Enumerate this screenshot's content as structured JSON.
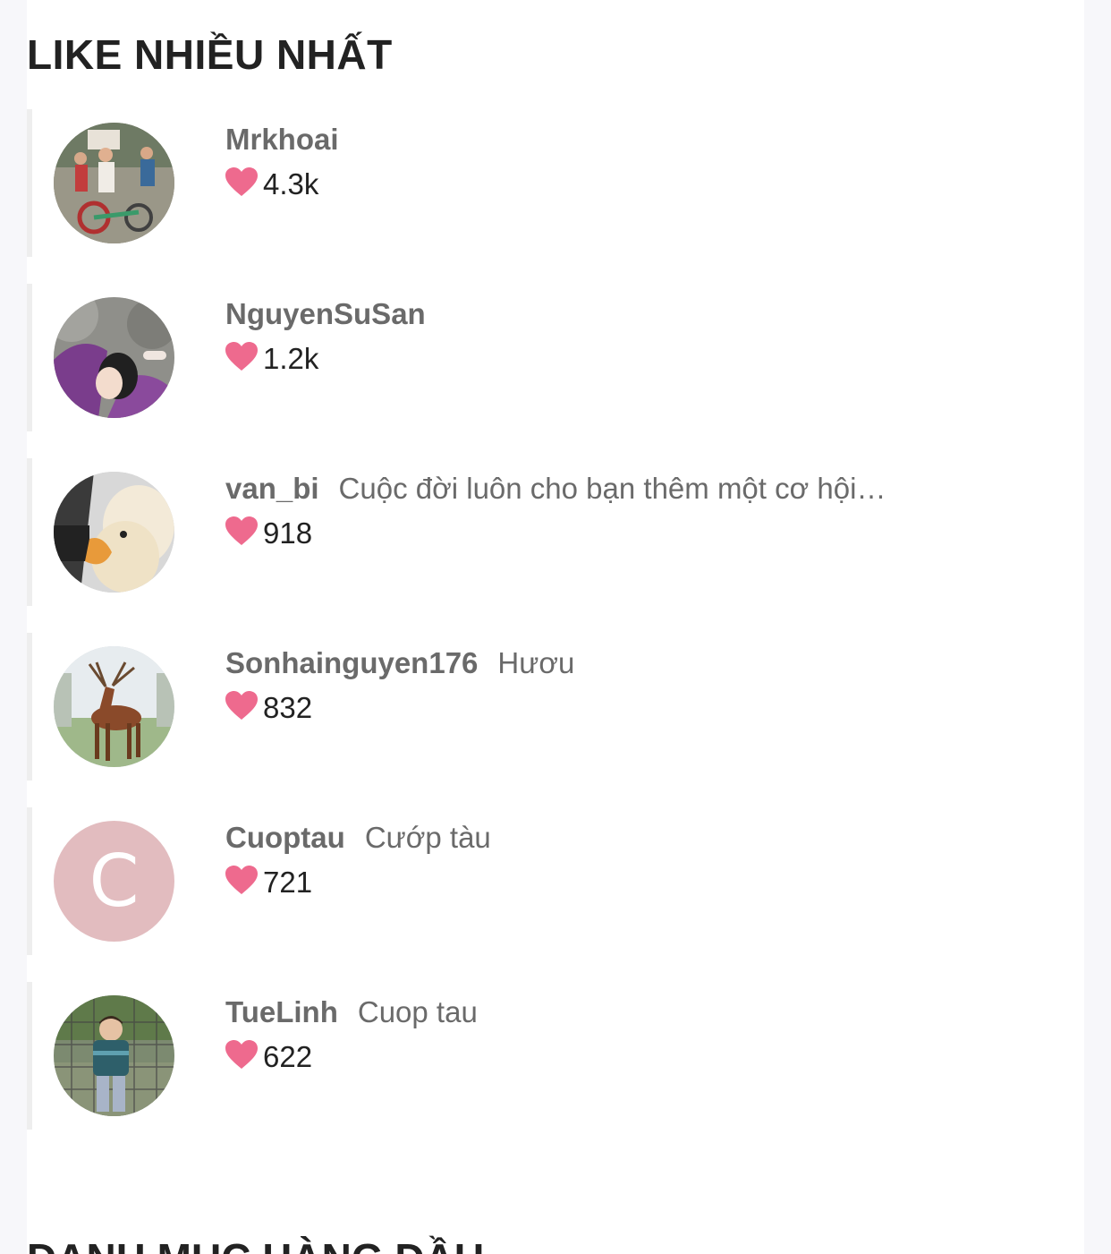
{
  "section_title": "LIKE NHIỀU NHẤT",
  "next_section_title": "DANH MỤC HÀNG ĐẦU",
  "colors": {
    "heart": "#ee6a8e",
    "username": "#6a6a6a",
    "letter_avatar_bg": "#e2bcbf"
  },
  "items": [
    {
      "username": "Mrkhoai",
      "caption": "",
      "likes": "4.3k"
    },
    {
      "username": "NguyenSuSan",
      "caption": "",
      "likes": "1.2k"
    },
    {
      "username": "van_bi",
      "caption": "Cuộc đời luôn cho bạn thêm một cơ hội…",
      "likes": "918"
    },
    {
      "username": "Sonhainguyen176",
      "caption": "Hươu",
      "likes": "832"
    },
    {
      "username": "Cuoptau",
      "caption": "Cướp tàu",
      "likes": "721",
      "avatar_letter": "C"
    },
    {
      "username": "TueLinh",
      "caption": "Cuop tau",
      "likes": "622"
    }
  ]
}
